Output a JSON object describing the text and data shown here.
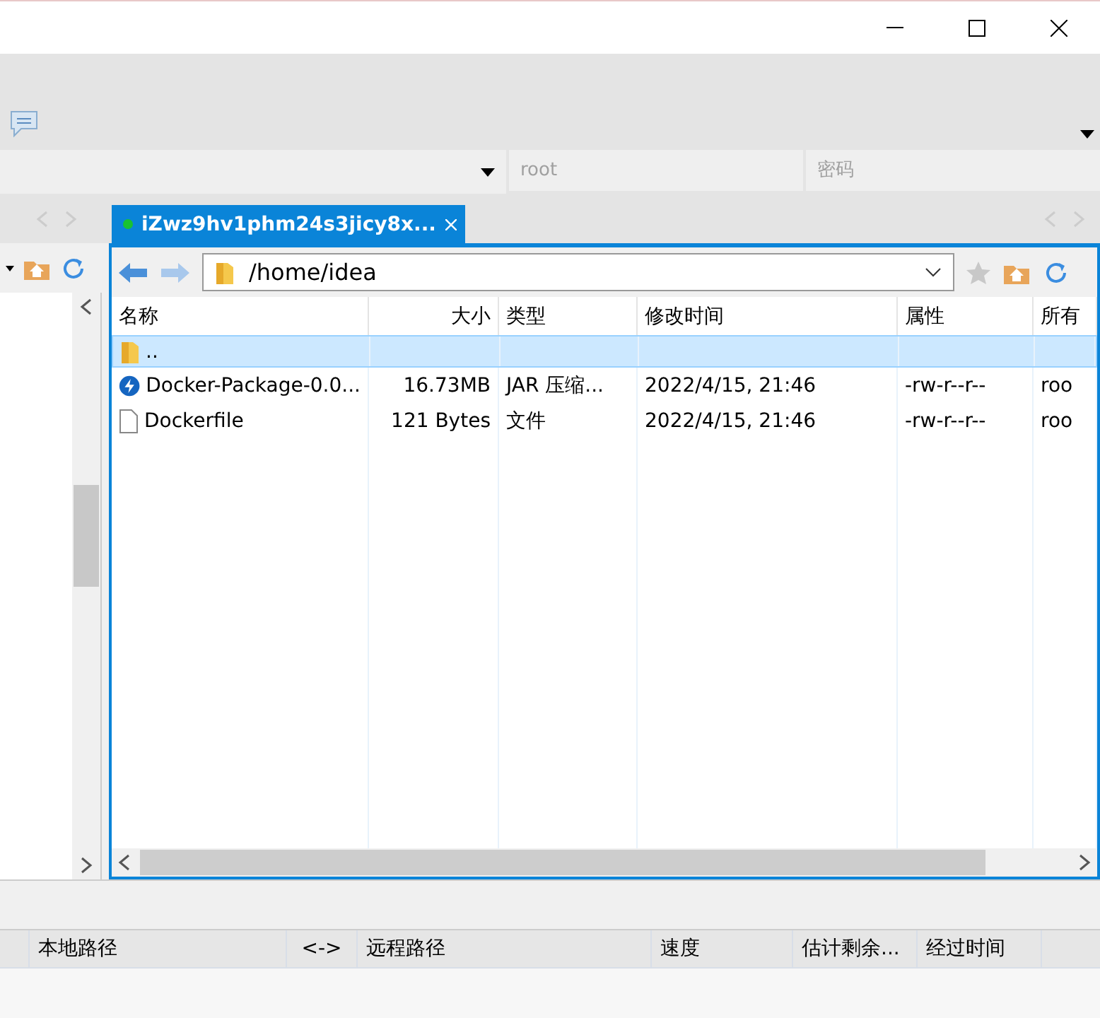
{
  "connection": {
    "user_placeholder": "root",
    "password_placeholder": "密码"
  },
  "tabs": [
    {
      "label": "iZwz9hv1phm24s3jicy8x...",
      "selected": true,
      "connected": true
    }
  ],
  "remote_path": "/home/idea",
  "file_table": {
    "columns": [
      "名称",
      "大小",
      "类型",
      "修改时间",
      "属性",
      "所有"
    ],
    "rows": [
      {
        "kind": "folder",
        "selected": true,
        "cells": [
          "..",
          "",
          "",
          "",
          "",
          ""
        ]
      },
      {
        "kind": "jar",
        "selected": false,
        "cells": [
          "Docker-Package-0.0...",
          "16.73MB",
          "JAR 压缩...",
          "2022/4/15, 21:46",
          "-rw-r--r--",
          "roo"
        ]
      },
      {
        "kind": "file",
        "selected": false,
        "cells": [
          "Dockerfile",
          "121 Bytes",
          "文件",
          "2022/4/15, 21:46",
          "-rw-r--r--",
          "roo"
        ]
      }
    ]
  },
  "transfer_queue": {
    "columns": [
      "本地路径",
      "<->",
      "远程路径",
      "速度",
      "估计剩余...",
      "经过时间"
    ]
  }
}
